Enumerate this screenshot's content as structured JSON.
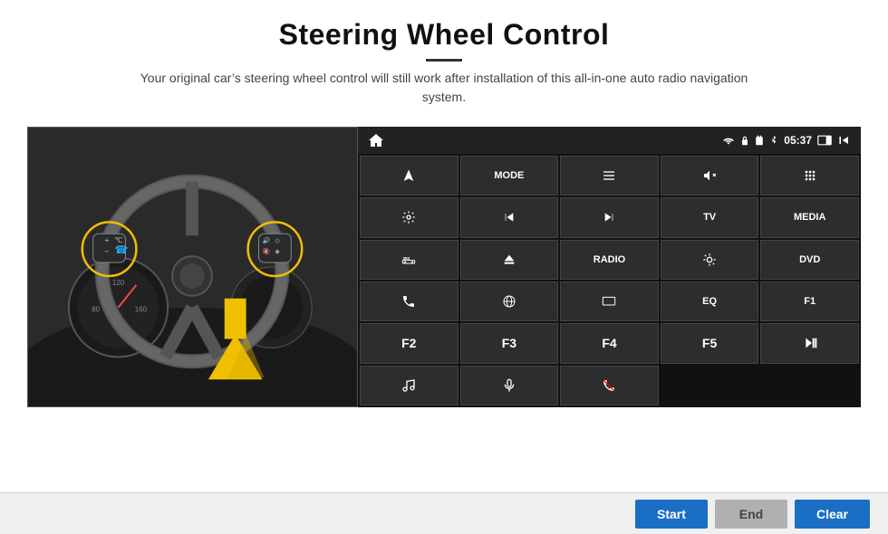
{
  "page": {
    "title": "Steering Wheel Control",
    "subtitle": "Your original car’s steering wheel control will still work after installation of this all-in-one auto radio navigation system.",
    "divider": "—"
  },
  "status_bar": {
    "time": "05:37"
  },
  "buttons": [
    {
      "id": "nav",
      "icon": "nav",
      "label": ""
    },
    {
      "id": "mode",
      "icon": "",
      "label": "MODE"
    },
    {
      "id": "menu",
      "icon": "menu",
      "label": ""
    },
    {
      "id": "mute",
      "icon": "mute",
      "label": ""
    },
    {
      "id": "apps",
      "icon": "apps",
      "label": ""
    },
    {
      "id": "settings",
      "icon": "settings",
      "label": ""
    },
    {
      "id": "prev",
      "icon": "prev",
      "label": ""
    },
    {
      "id": "next",
      "icon": "next",
      "label": ""
    },
    {
      "id": "tv",
      "icon": "",
      "label": "TV"
    },
    {
      "id": "media",
      "icon": "",
      "label": "MEDIA"
    },
    {
      "id": "cam360",
      "icon": "360",
      "label": ""
    },
    {
      "id": "eject",
      "icon": "eject",
      "label": ""
    },
    {
      "id": "radio",
      "icon": "",
      "label": "RADIO"
    },
    {
      "id": "brightness",
      "icon": "sun",
      "label": ""
    },
    {
      "id": "dvd",
      "icon": "",
      "label": "DVD"
    },
    {
      "id": "phone",
      "icon": "phone",
      "label": ""
    },
    {
      "id": "globe",
      "icon": "globe",
      "label": ""
    },
    {
      "id": "screen",
      "icon": "screen",
      "label": ""
    },
    {
      "id": "eq",
      "icon": "",
      "label": "EQ"
    },
    {
      "id": "f1",
      "icon": "",
      "label": "F1"
    },
    {
      "id": "f2",
      "icon": "",
      "label": "F2"
    },
    {
      "id": "f3",
      "icon": "",
      "label": "F3"
    },
    {
      "id": "f4",
      "icon": "",
      "label": "F4"
    },
    {
      "id": "f5",
      "icon": "",
      "label": "F5"
    },
    {
      "id": "playpause",
      "icon": "playpause",
      "label": ""
    },
    {
      "id": "music",
      "icon": "music",
      "label": ""
    },
    {
      "id": "mic",
      "icon": "mic",
      "label": ""
    },
    {
      "id": "hangup",
      "icon": "hangup",
      "label": ""
    }
  ],
  "bottom_controls": {
    "start_label": "Start",
    "end_label": "End",
    "clear_label": "Clear"
  }
}
